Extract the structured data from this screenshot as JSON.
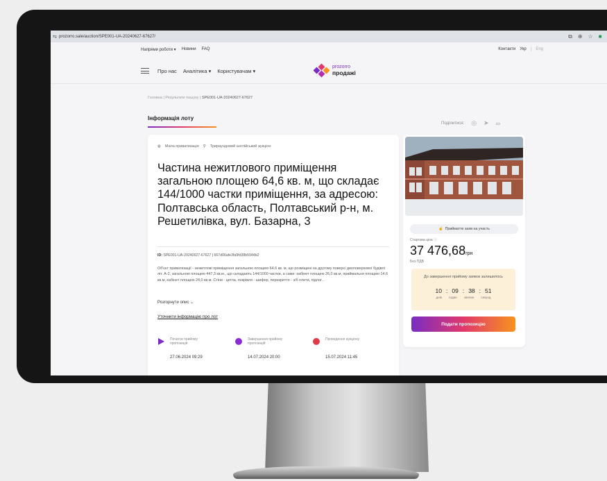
{
  "browser": {
    "url": "prozorro.sale/auction/SPE001-UA-20240627-67627/",
    "icons": [
      "screen-icon",
      "zoom-icon",
      "star-icon",
      "extension-green-icon",
      "extension-blue-icon",
      "pen-icon"
    ]
  },
  "topnav": {
    "directions": "Напрями роботи ▾",
    "news": "Новини",
    "faq": "FAQ",
    "contacts": "Контакти",
    "lang_ukr": "Укр",
    "lang_sep": "|",
    "lang_eng": "Eng"
  },
  "mainnav": {
    "about": "Про нас",
    "analytics": "Аналітика ▾",
    "users": "Користувачам ▾"
  },
  "logo": {
    "line1": "prozorro",
    "line2": "продажі"
  },
  "breadcrumb": {
    "home": "Головна",
    "sep1": "|",
    "results": "Результати пошуку",
    "sep2": "|",
    "current": "SPE001-UA-20240627-67627"
  },
  "tab": {
    "label": "Інформація лоту"
  },
  "share": {
    "label": "Поділитися:"
  },
  "lot": {
    "tag1": "Мала приватизація",
    "tag2": "Трираундовий англійський аукціон",
    "title": "Частина нежитлового приміщення загальною площею 64,6 кв. м, що складає 144/1000 частки приміщення, за адресою: Полтавська область, Полтавський р-н, м. Решетилівка, вул. Базарна, 3",
    "id_label": "ID:",
    "id_value": "SPE001-UA-20240627-67627 | 667d06afe3fa9fd38b5944b2",
    "description": "Об'єкт приватизації - нежитлові приміщення загальною площею 64,6 кв. м, що розміщені на другому поверсі двоповерхової будівлі літ. А-2, загальною площею 447,3 кв.м., що складають 144/1000 частки, а саме: кабінет площею 26,0 кв.м, приймальня площею 14,6 кв.м, кабінет площею 24,0 кв.м. Стіни - цегла, покрівля - шифер, перекриття - з/б плити, підлог...",
    "expand": "Розгорнути опис ⌄",
    "clarify": "Уточнити інформацію про лот"
  },
  "timeline": [
    {
      "label": "Початок прийому пропозицій",
      "date": "27.06.2024  09:29",
      "color": "#7a2cc4",
      "shape": "triangle"
    },
    {
      "label": "Завершення прийому пропозицій",
      "date": "14.07.2024  20:00",
      "color": "#8a2ad0",
      "shape": "circle"
    },
    {
      "label": "Проведення аукціону",
      "date": "15.07.2024  11:45",
      "color": "#e0394a",
      "shape": "circle"
    }
  ],
  "side": {
    "apply_pill": "Прийматте заяв на участь",
    "start_price_label": "Стартова ціна",
    "price": "37 476,68",
    "currency": "грн",
    "vat": "Без ПДВ",
    "countdown_title": "До завершення прийому заявок залишилось",
    "countdown": {
      "days": "10",
      "hours": "09",
      "minutes": "38",
      "seconds": "51"
    },
    "countdown_sep": ":",
    "units": {
      "days": "днів",
      "hours": "годин",
      "minutes": "хвилин",
      "seconds": "секунд"
    },
    "bid_button": "Подати пропозицію"
  },
  "colors": {
    "brand_purple": "#7a2cc4",
    "brand_pink": "#e0396b",
    "brand_orange": "#f7931e",
    "countdown_bg": "#fdf0d8"
  }
}
